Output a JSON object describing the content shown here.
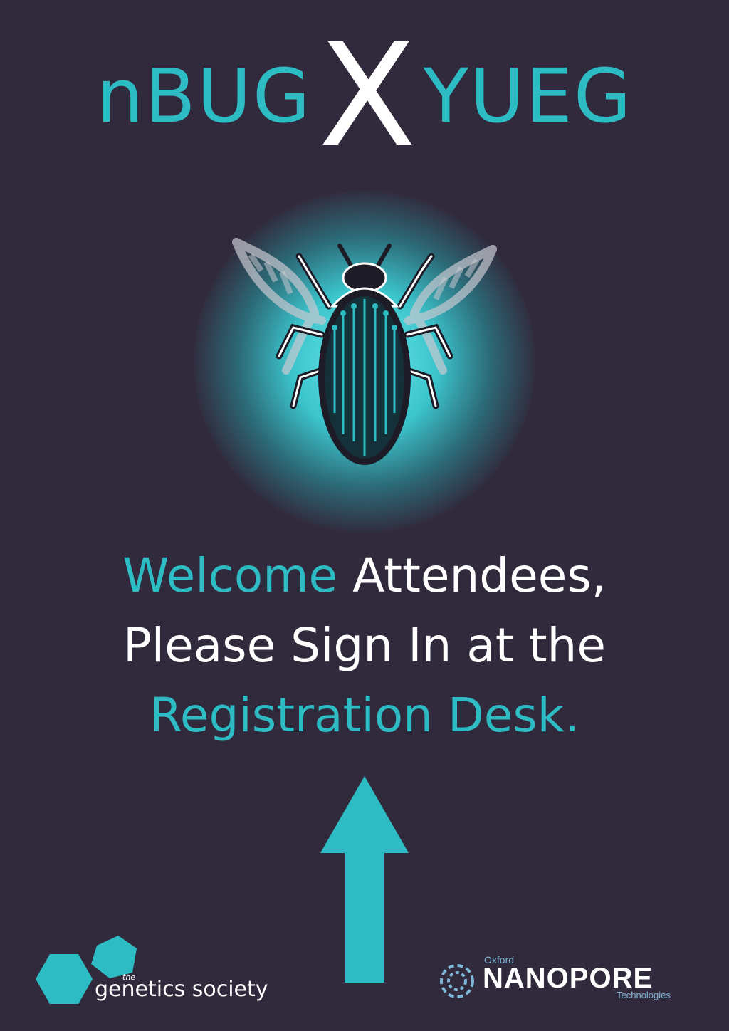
{
  "header": {
    "left": "nBUG",
    "separator": "X",
    "right": "YUEG"
  },
  "message": {
    "line1_teal": "Welcome",
    "line1_white": " Attendees,",
    "line2": "Please Sign In at the",
    "line3": "Registration Desk."
  },
  "logos": {
    "genetics_society": {
      "small": "the",
      "name": "genetics society"
    },
    "nanopore": {
      "top": "Oxford",
      "name": "NANOPORE",
      "bottom": "Technologies"
    }
  },
  "colors": {
    "background": "#312a3c",
    "accent": "#2ebcc4",
    "text": "#ffffff"
  },
  "icons": {
    "emblem": "beetle-dna-icon",
    "arrow": "arrow-up-icon"
  }
}
